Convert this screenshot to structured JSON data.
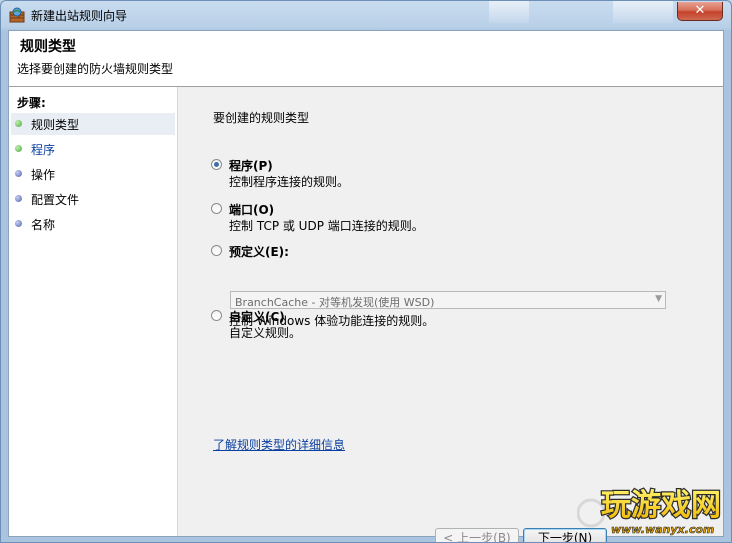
{
  "window": {
    "title": "新建出站规则向导"
  },
  "header": {
    "title": "规则类型",
    "subtitle": "选择要创建的防火墙规则类型"
  },
  "steps": {
    "title": "步骤:",
    "items": [
      {
        "label": "规则类型",
        "status": "done"
      },
      {
        "label": "程序",
        "status": "done"
      },
      {
        "label": "操作",
        "status": "pending"
      },
      {
        "label": "配置文件",
        "status": "pending"
      },
      {
        "label": "名称",
        "status": "pending"
      }
    ]
  },
  "main": {
    "prompt": "要创建的规则类型",
    "options": [
      {
        "label": "程序(P)",
        "desc": "控制程序连接的规则。",
        "selected": true
      },
      {
        "label": "端口(O)",
        "desc": "控制 TCP 或 UDP 端口连接的规则。",
        "selected": false
      },
      {
        "label": "预定义(E):",
        "desc": "控制 Windows 体验功能连接的规则。",
        "selected": false
      },
      {
        "label": "自定义(C)",
        "desc": "自定义规则。",
        "selected": false
      }
    ],
    "predefined_select": "BranchCache - 对等机发现(使用 WSD)",
    "learn_more_link": "了解规则类型的详细信息"
  },
  "buttons": {
    "back": "< 上一步(B)",
    "next": "下一步(N)"
  },
  "watermark": {
    "text": "玩游戏网",
    "url": "www.wanyx.com"
  },
  "colors": {
    "step_done": "#5cb85c",
    "step_pending": "#5a6fb8",
    "link": "#0b3fa0"
  }
}
